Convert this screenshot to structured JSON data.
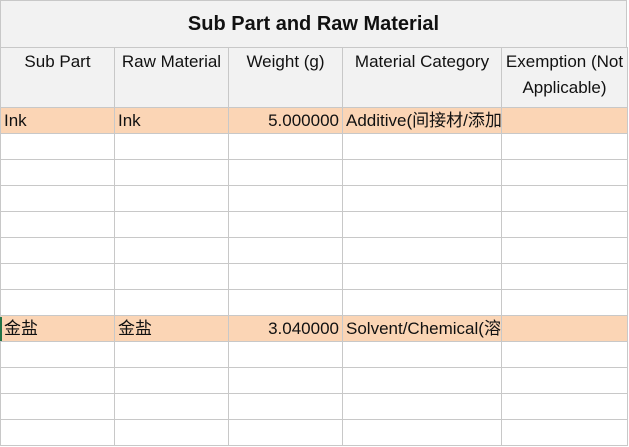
{
  "sheet": {
    "title": "Sub Part and Raw Material",
    "columns": [
      "Sub Part",
      "Raw Material",
      "Weight (g)",
      "Material Category",
      "Exemption (Not Applicable)"
    ],
    "rows": [
      {
        "sub_part": "Ink",
        "raw_material": "Ink",
        "weight": "5.000000",
        "category": "Additive(间接材/添加物)",
        "exemption": ""
      },
      {
        "sub_part": "",
        "raw_material": "",
        "weight": "",
        "category": "",
        "exemption": ""
      },
      {
        "sub_part": "",
        "raw_material": "",
        "weight": "",
        "category": "",
        "exemption": ""
      },
      {
        "sub_part": "",
        "raw_material": "",
        "weight": "",
        "category": "",
        "exemption": ""
      },
      {
        "sub_part": "",
        "raw_material": "",
        "weight": "",
        "category": "",
        "exemption": ""
      },
      {
        "sub_part": "",
        "raw_material": "",
        "weight": "",
        "category": "",
        "exemption": ""
      },
      {
        "sub_part": "",
        "raw_material": "",
        "weight": "",
        "category": "",
        "exemption": ""
      },
      {
        "sub_part": "",
        "raw_material": "",
        "weight": "",
        "category": "",
        "exemption": ""
      },
      {
        "sub_part": "金盐",
        "raw_material": "金盐",
        "weight": "3.040000",
        "category": "Solvent/Chemical(溶剂/化学品)",
        "exemption": ""
      },
      {
        "sub_part": "",
        "raw_material": "",
        "weight": "",
        "category": "",
        "exemption": ""
      },
      {
        "sub_part": "",
        "raw_material": "",
        "weight": "",
        "category": "",
        "exemption": ""
      },
      {
        "sub_part": "",
        "raw_material": "",
        "weight": "",
        "category": "",
        "exemption": ""
      },
      {
        "sub_part": "",
        "raw_material": "",
        "weight": "",
        "category": "",
        "exemption": ""
      }
    ]
  },
  "colors": {
    "highlight_row": "#fbd5b5",
    "header_bg": "#f2f2f2",
    "gridline": "#c8c8c8"
  }
}
